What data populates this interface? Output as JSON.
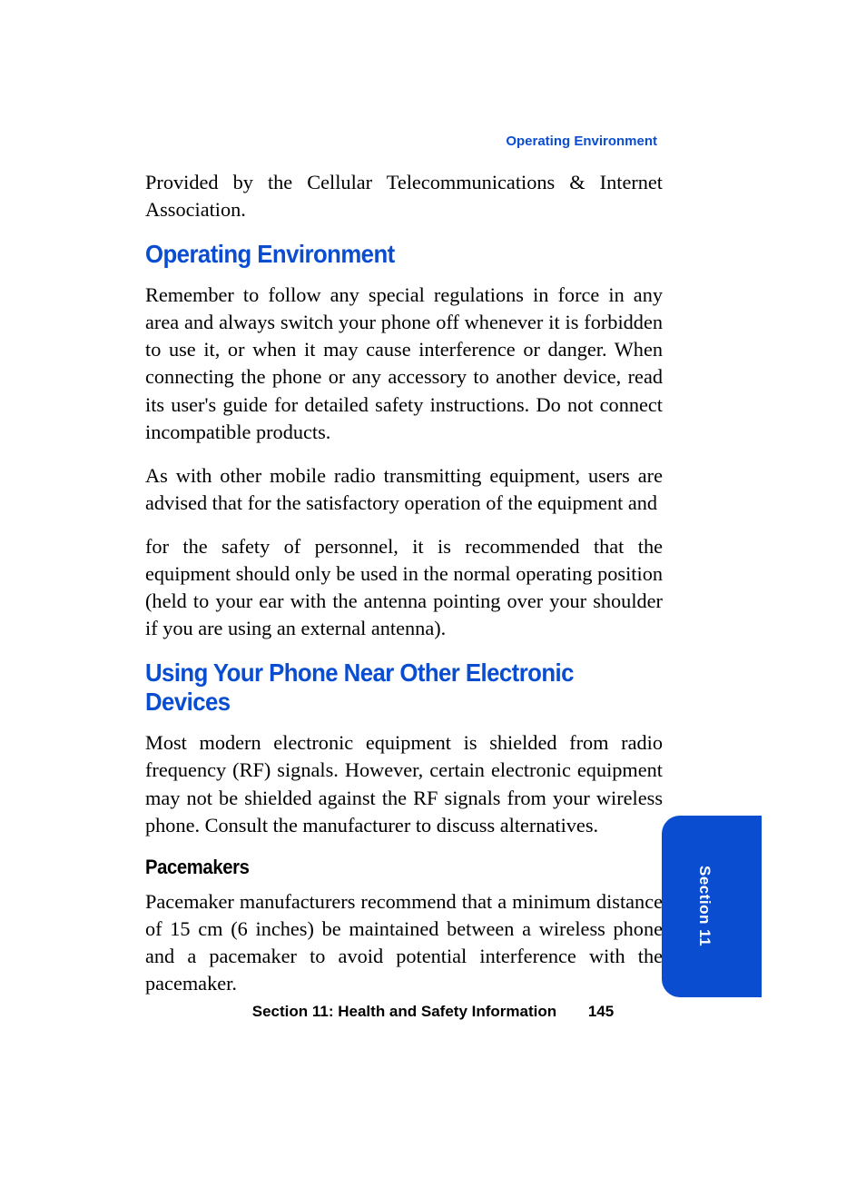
{
  "header": {
    "running_title": "Operating Environment"
  },
  "content": {
    "intro": "Provided by the Cellular Telecommunications & Internet Association.",
    "section1_title": "Operating Environment",
    "section1_p1": "Remember to follow any special regulations in force in any area and always switch your phone off whenever it is forbidden to use it, or when it may cause interference or danger. When connecting the phone or any accessory to another device, read its user's guide for detailed safety instructions. Do not connect incompatible products.",
    "section1_p2": "As with other mobile radio transmitting equipment, users are advised that for the satisfactory operation of the equipment and",
    "section1_p3": "for the safety of personnel, it is recommended that the equipment should only be used in the normal operating position (held to your ear with the antenna pointing over your shoulder if you are using an external antenna).",
    "section2_title": "Using Your Phone Near Other Electronic Devices",
    "section2_p1": "Most modern electronic equipment is shielded from radio frequency (RF) signals. However, certain electronic equipment may not be shielded against the RF signals from your wireless phone. Consult the manufacturer to discuss alternatives.",
    "subsection_title": "Pacemakers",
    "subsection_p1": "Pacemaker manufacturers recommend that a minimum distance of 15 cm (6 inches) be maintained between a wireless phone and a pacemaker to avoid potential interference with the pacemaker."
  },
  "footer": {
    "section_label": "Section 11: Health and Safety Information",
    "page_number": "145"
  },
  "tab": {
    "label": "Section 11"
  }
}
